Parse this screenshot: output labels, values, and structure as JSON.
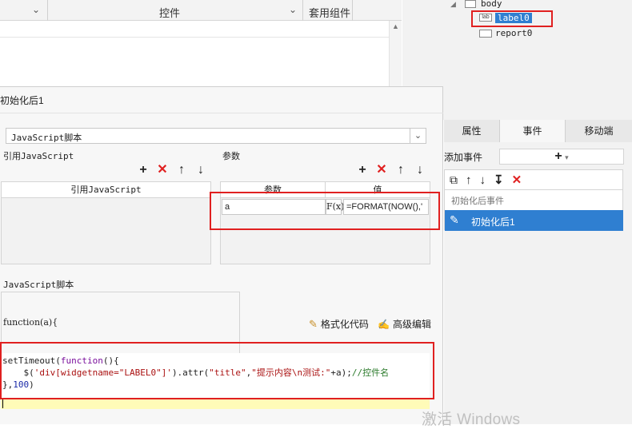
{
  "background_window": {
    "col_label_controls": "控件",
    "col_label_template": "套用组件"
  },
  "tree": {
    "body": "body",
    "label_icon": "lab",
    "label_node": "label0",
    "report_node": "report0"
  },
  "dialog": {
    "title": "初始化后1",
    "script_type": "JavaScript脚本",
    "ref_js_section": "引用JavaScript",
    "ref_js_header": "引用JavaScript",
    "params_section": "参数",
    "params_header_name": "参数",
    "params_header_value": "值",
    "param_rows": [
      {
        "name": "a",
        "fx": "F(x)",
        "value": "=FORMAT(NOW(),'"
      }
    ],
    "js_script_label": "JavaScript脚本",
    "function_signature": "function(a){",
    "format_code_label": "格式化代码",
    "advanced_edit_label": "高级编辑",
    "code": {
      "line1_a": "setTimeout(",
      "line1_b": "function",
      "line1_c": "(){",
      "line2_a": "    $(",
      "line2_b": "'div[widgetname=\"LABEL0\"]'",
      "line2_c": ").attr(",
      "line2_d": "\"title\"",
      "line2_e": ",",
      "line2_f": "\"提示内容\\n测试:\"",
      "line2_g": "+a);",
      "line2_h": "//控件名",
      "line3_a": "},",
      "line3_b": "100",
      "line3_c": ")"
    }
  },
  "right_panel": {
    "tabs": [
      "属性",
      "事件",
      "移动端"
    ],
    "active_tab": "事件",
    "add_event_label": "添加事件",
    "add_symbol": "+",
    "add_dropdown_symbol": "▾",
    "event_group": "初始化后事件",
    "event_item": "初始化后1"
  },
  "icons": {
    "plus": "+",
    "delete": "✕",
    "up": "↑",
    "down": "↓"
  },
  "watermark": "激活 Windows",
  "colors": {
    "highlight_red": "#e02020",
    "selected_blue": "#2f7fd1",
    "js_keyword": "#7a0f9c",
    "js_string": "#a11",
    "js_comment": "#2a7a2a"
  }
}
